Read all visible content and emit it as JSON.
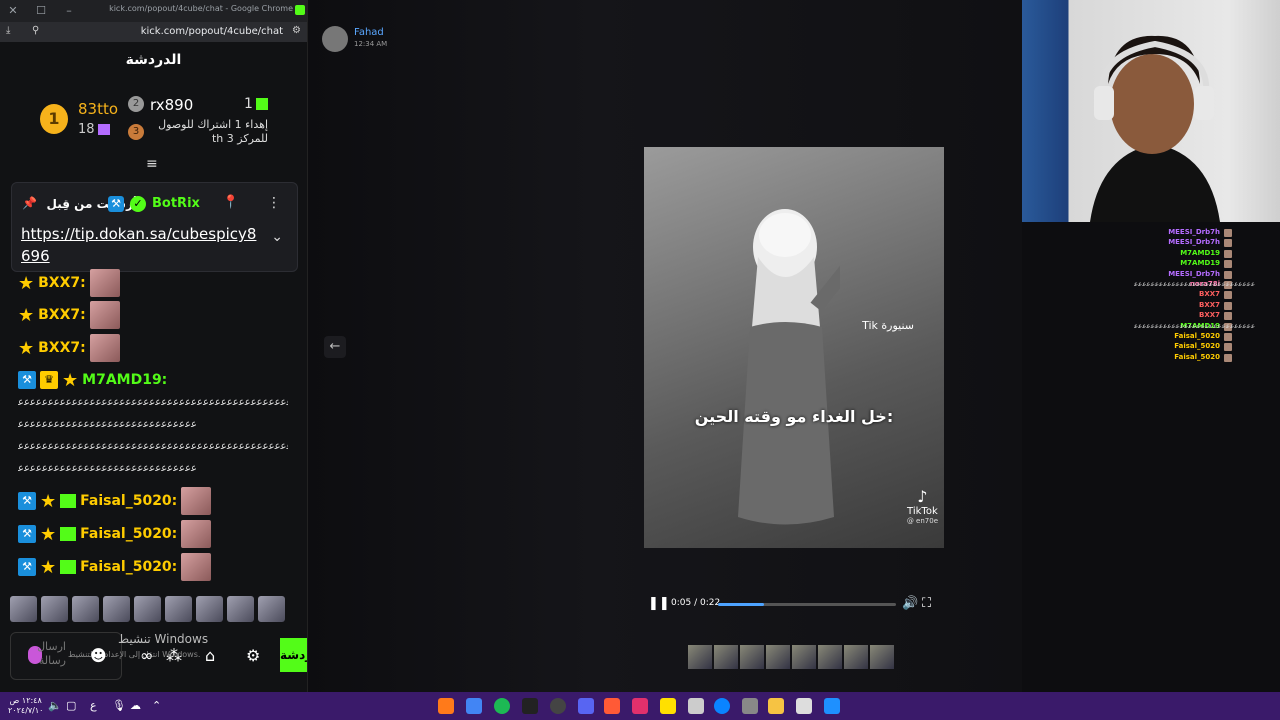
{
  "window": {
    "title": "kick.com/popout/4cube/chat - Google Chrome",
    "url": "kick.com/popout/4cube/chat"
  },
  "chat": {
    "title": "الدردشة",
    "leaderboard": {
      "first_name": "83tto",
      "first_count": "18",
      "second_name": "rx890",
      "second_rank": "2",
      "third_rank": "3",
      "goal_text": "إهداء 1 اشتراك للوصول للمركز 3 th",
      "right_count": "1",
      "first_rank": "1"
    },
    "pinned": {
      "label": "أرسلت من قِبل",
      "sender": "BotRix",
      "link": "https://tip.dokan.sa/cubespicy8696"
    },
    "messages": [
      {
        "user": "BXX7:",
        "color": "#ffcc00"
      },
      {
        "user": "BXX7:",
        "color": "#ffcc00"
      },
      {
        "user": "BXX7:",
        "color": "#ffcc00"
      },
      {
        "user": "M7AMD19:",
        "color": "#53fc18"
      },
      {
        "user": "Faisal_5020:",
        "color": "#ffcc00"
      },
      {
        "user": "Faisal_5020:",
        "color": "#ffcc00"
      },
      {
        "user": "Faisal_5020:",
        "color": "#ffcc00"
      }
    ],
    "spam_lines": [
      "ﻋﻋﻋﻋﻋﻋﻋﻋﻋﻋﻋﻋﻋﻋﻋﻋﻋﻋﻋﻋﻋﻋﻋﻋﻋﻋﻋﻋﻋﻋﻋﻋﻋﻋﻋﻋﻋﻋﻋﻋﻋﻋﻋﻋﻋﻋﻋﻋﻋ",
      "ﻋﻋﻋﻋﻋﻋﻋﻋﻋﻋﻋﻋﻋﻋﻋﻋﻋﻋﻋﻋﻋﻋﻋﻋﻋﻋﻋﻋﻋﻋ",
      "ﻋﻋﻋﻋﻋﻋﻋﻋﻋﻋﻋﻋﻋﻋﻋﻋﻋﻋﻋﻋﻋﻋﻋﻋﻋﻋﻋﻋﻋﻋﻋﻋﻋﻋﻋﻋﻋﻋﻋﻋﻋﻋﻋﻋﻋﻋﻋﻋﻋ",
      "ﻋﻋﻋﻋﻋﻋﻋﻋﻋﻋﻋﻋﻋﻋﻋﻋﻋﻋﻋﻋﻋﻋﻋﻋﻋﻋﻋﻋﻋﻋ"
    ],
    "input_placeholder": "ارسال رسالة",
    "activate_windows": "تنشيط Windows",
    "activate_windows_sub": "انتقل إلى الإعدادات لتنشيط Windows.",
    "send_label": "دردشة"
  },
  "center": {
    "sender_name": "Fahad",
    "sender_time": "12:34 AM",
    "video_caption": "خل الغداء مو وقته الحين:",
    "video_stamp": "Tik سنيورة",
    "watermark": "TikTok",
    "watermark_handle": "@ en70e",
    "time": "0:05 / 0:22",
    "progress": 0.26
  },
  "overlay_chat": [
    {
      "user": "MEESI_Drb7h",
      "color": "#b46cff",
      "msg": ""
    },
    {
      "user": "MEESI_Drb7h",
      "color": "#b46cff",
      "msg": ""
    },
    {
      "user": "M7AMD19",
      "color": "#53fc18",
      "msg": ""
    },
    {
      "user": "M7AMD19",
      "color": "#53fc18",
      "msg": ""
    },
    {
      "user": "MEESI_Drb7h",
      "color": "#b46cff",
      "msg": ""
    },
    {
      "user": "nora78i",
      "color": "#ff6fa8",
      "msg": "ﻋﻋﻋﻋﻋﻋﻋﻋﻋﻋﻋﻋﻋﻋﻋﻋﻋﻋﻋﻋﻋﻋﻋﻋﻋﻋﻋﻋﻋ"
    },
    {
      "user": "BXX7",
      "color": "#ff6060",
      "msg": ""
    },
    {
      "user": "BXX7",
      "color": "#ff6060",
      "msg": ""
    },
    {
      "user": "BXX7",
      "color": "#ff6060",
      "msg": ""
    },
    {
      "user": "M7AMD19",
      "color": "#53fc18",
      "msg": "ﻋﻋﻋﻋﻋﻋﻋﻋﻋﻋﻋﻋﻋﻋﻋﻋﻋﻋﻋﻋﻋﻋﻋﻋﻋﻋﻋﻋﻋ"
    },
    {
      "user": "Faisal_5020",
      "color": "#ffcc00",
      "msg": ""
    },
    {
      "user": "Faisal_5020",
      "color": "#ffcc00",
      "msg": ""
    },
    {
      "user": "Faisal_5020",
      "color": "#ffcc00",
      "msg": ""
    }
  ],
  "taskbar": {
    "time": "١٢:٤٨ ص",
    "date": "٢٠٢٤/٧/١٠"
  },
  "colors": {
    "kick_green": "#53fc18",
    "taskbar": "#3a1a6a"
  }
}
